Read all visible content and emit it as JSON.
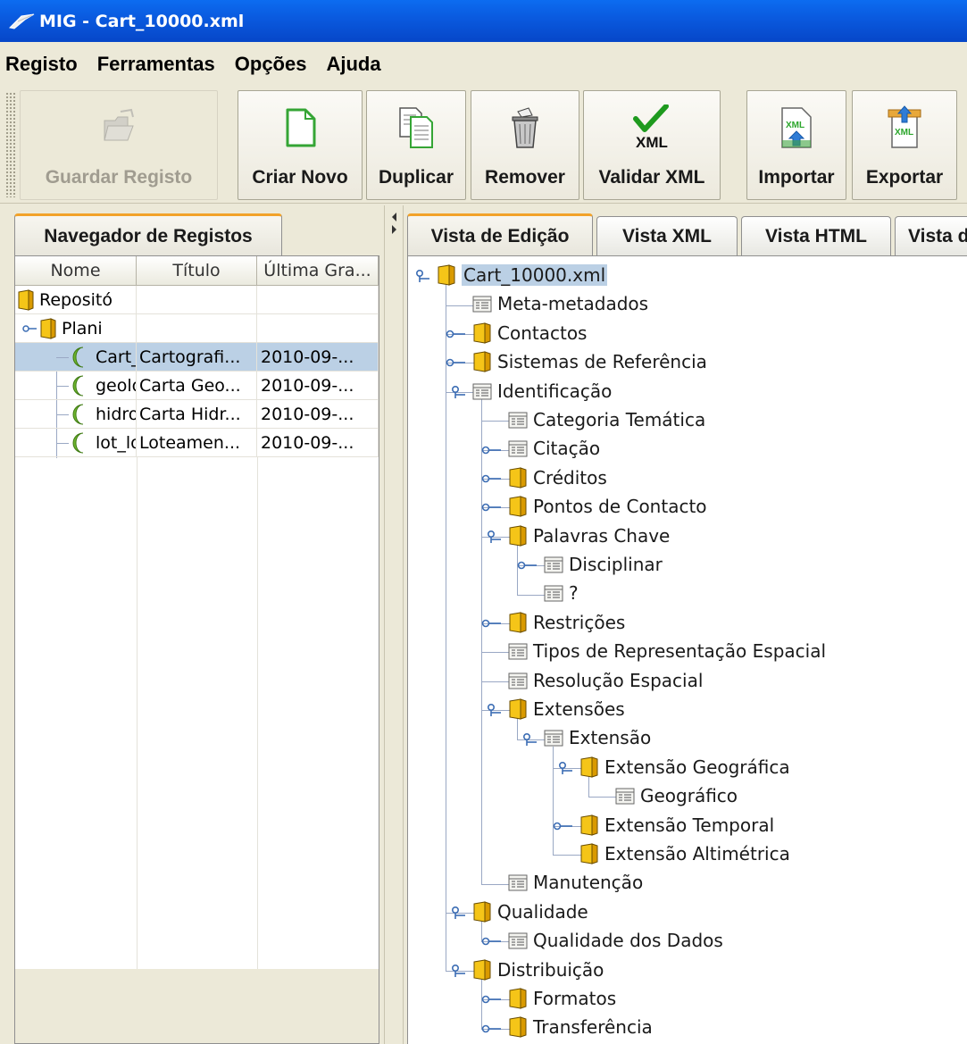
{
  "window": {
    "title": "MIG - Cart_10000.xml"
  },
  "menu": [
    "Registo",
    "Ferramentas",
    "Opções",
    "Ajuda"
  ],
  "toolbar": {
    "buttons": [
      {
        "label": "Guardar Registo",
        "icon": "folder-open-icon",
        "enabled": false
      },
      {
        "label": "Criar Novo",
        "icon": "new-document-icon",
        "enabled": true
      },
      {
        "label": "Duplicar",
        "icon": "duplicate-icon",
        "enabled": true
      },
      {
        "label": "Remover",
        "icon": "trash-icon",
        "enabled": true
      },
      {
        "label": "Validar XML",
        "icon": "validate-xml-icon",
        "enabled": true
      },
      {
        "label": "Importar",
        "icon": "import-xml-icon",
        "enabled": true
      },
      {
        "label": "Exportar",
        "icon": "export-xml-icon",
        "enabled": true
      }
    ],
    "validate_icon_text": "XML",
    "import_icon_text": "XML",
    "export_icon_text": "XML"
  },
  "left": {
    "tab": "Navegador de Registos",
    "columns": [
      "Nome",
      "Título",
      "Última Gra..."
    ],
    "rows": [
      {
        "nome": "Repositó",
        "titulo": "",
        "ultima": "",
        "icon": "folder-icon",
        "selected": false
      },
      {
        "nome": "Plani",
        "titulo": "",
        "ultima": "",
        "icon": "folder-icon",
        "selected": false
      },
      {
        "nome": "Cart_",
        "titulo": "Cartografi...",
        "ultima": "2010-09-...",
        "icon": "record-icon",
        "selected": true
      },
      {
        "nome": "geolo",
        "titulo": "Carta Geo...",
        "ultima": "2010-09-...",
        "icon": "record-icon",
        "selected": false
      },
      {
        "nome": "hidro",
        "titulo": "Carta Hidr...",
        "ultima": "2010-09-...",
        "icon": "record-icon",
        "selected": false
      },
      {
        "nome": "lot_lo",
        "titulo": "Loteamen...",
        "ultima": "2010-09-...",
        "icon": "record-icon",
        "selected": false
      }
    ]
  },
  "right": {
    "tabs": [
      "Vista de Edição",
      "Vista XML",
      "Vista HTML",
      "Vista d"
    ],
    "active_tab": "Vista de Edição",
    "tree": [
      {
        "label": "Cart_10000.xml",
        "icon": "folder-icon",
        "depth": 0,
        "expanded": true,
        "selected": true
      },
      {
        "label": "Meta-metadados",
        "icon": "form-icon",
        "depth": 1
      },
      {
        "label": "Contactos",
        "icon": "folder-icon",
        "depth": 1,
        "expandable": true
      },
      {
        "label": "Sistemas de Referência",
        "icon": "folder-icon",
        "depth": 1,
        "expandable": true
      },
      {
        "label": "Identificação",
        "icon": "form-icon",
        "depth": 1,
        "expanded": true
      },
      {
        "label": "Categoria Temática",
        "icon": "form-icon",
        "depth": 2
      },
      {
        "label": "Citação",
        "icon": "form-icon",
        "depth": 2,
        "expandable": true
      },
      {
        "label": "Créditos",
        "icon": "folder-icon",
        "depth": 2,
        "expandable": true
      },
      {
        "label": "Pontos de Contacto",
        "icon": "folder-icon",
        "depth": 2,
        "expandable": true
      },
      {
        "label": "Palavras Chave",
        "icon": "folder-icon",
        "depth": 2,
        "expanded": true
      },
      {
        "label": "Disciplinar",
        "icon": "form-icon",
        "depth": 3,
        "expandable": true
      },
      {
        "label": "?",
        "icon": "form-icon",
        "depth": 3
      },
      {
        "label": "Restrições",
        "icon": "folder-icon",
        "depth": 2,
        "expandable": true
      },
      {
        "label": "Tipos de Representação Espacial",
        "icon": "form-icon",
        "depth": 2
      },
      {
        "label": "Resolução Espacial",
        "icon": "form-icon",
        "depth": 2
      },
      {
        "label": "Extensões",
        "icon": "folder-icon",
        "depth": 2,
        "expanded": true
      },
      {
        "label": "Extensão",
        "icon": "form-icon",
        "depth": 3,
        "expanded": true
      },
      {
        "label": "Extensão Geográfica",
        "icon": "folder-icon",
        "depth": 4,
        "expanded": true
      },
      {
        "label": "Geográfico",
        "icon": "form-icon",
        "depth": 5
      },
      {
        "label": "Extensão Temporal",
        "icon": "folder-icon",
        "depth": 4,
        "expandable": true
      },
      {
        "label": "Extensão Altimétrica",
        "icon": "folder-icon",
        "depth": 4
      },
      {
        "label": "Manutenção",
        "icon": "form-icon",
        "depth": 2
      },
      {
        "label": "Qualidade",
        "icon": "folder-icon",
        "depth": 1,
        "expanded": true
      },
      {
        "label": "Qualidade dos Dados",
        "icon": "form-icon",
        "depth": 2,
        "expandable": true
      },
      {
        "label": "Distribuição",
        "icon": "folder-icon",
        "depth": 1,
        "expanded": true
      },
      {
        "label": "Formatos",
        "icon": "folder-icon",
        "depth": 2,
        "expandable": true
      },
      {
        "label": "Transferência",
        "icon": "folder-icon",
        "depth": 2,
        "expandable": true
      }
    ]
  },
  "colors": {
    "titlebar": "#0A5BE0",
    "selection": "#BBD0E5",
    "active_tab_accent": "#F2A229",
    "folder": "#F5C518",
    "record": "#6EB52F"
  }
}
